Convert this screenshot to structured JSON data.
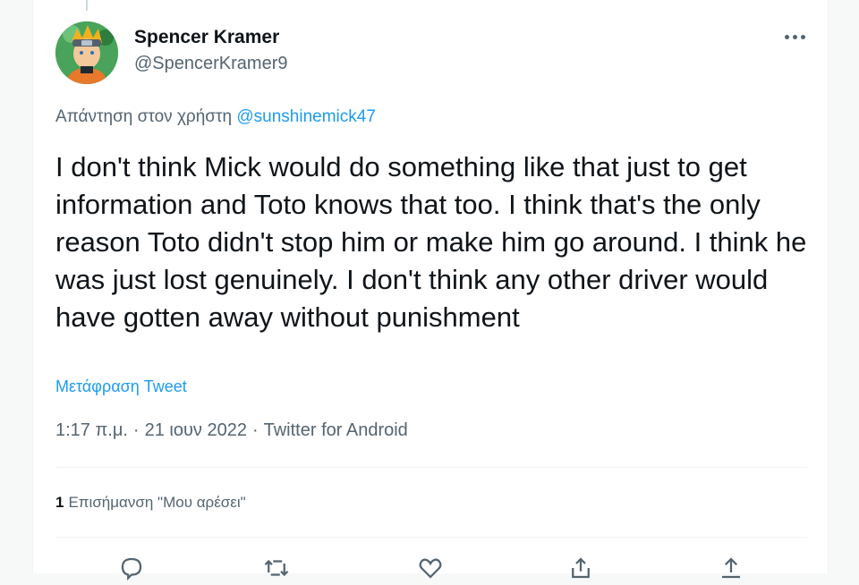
{
  "tweet": {
    "author_name": "Spencer Kramer",
    "author_handle": "@SpencerKramer9",
    "reply_prefix": "Απάντηση στον χρήστη",
    "reply_to": "@sunshinemick47",
    "text": "I don't think Mick would do something like that just to get information and Toto knows that too. I think that's the only reason Toto didn't stop him or make him go around. I think he was just lost genuinely. I don't think any other driver would have gotten away without punishment",
    "translate_label": "Μετάφραση Tweet",
    "time": "1:17 π.μ.",
    "date": "21 ιουν 2022",
    "source": "Twitter for Android",
    "separator": "·"
  },
  "stats": {
    "likes_count": "1",
    "likes_label": "Επισήμανση \"Μου αρέσει\""
  },
  "icons": {
    "more": "more-horizontal-icon",
    "reply": "reply-icon",
    "retweet": "retweet-icon",
    "like": "heart-icon",
    "share": "share-icon",
    "upload": "upload-icon"
  },
  "colors": {
    "accent": "#1d9bf0",
    "text_primary": "#0f1419",
    "text_secondary": "#536471",
    "border": "#eff3f4"
  }
}
